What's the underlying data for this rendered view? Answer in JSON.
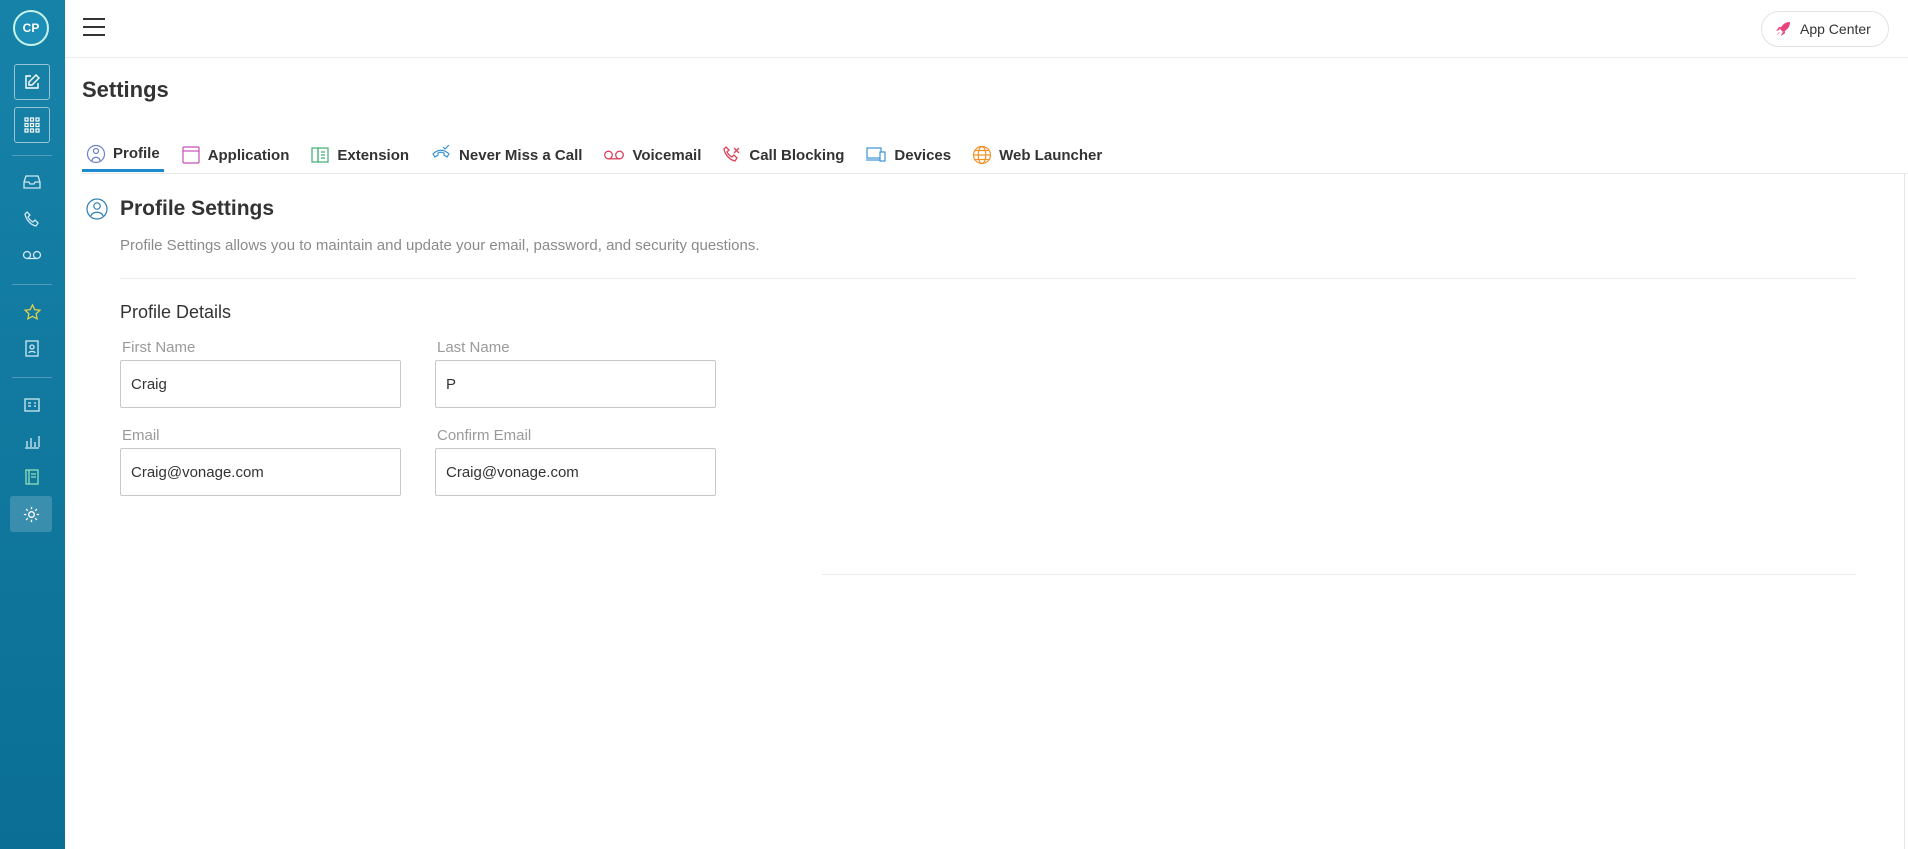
{
  "user": {
    "initials": "CP"
  },
  "header": {
    "app_center_label": "App Center"
  },
  "page": {
    "title": "Settings"
  },
  "tabs": [
    {
      "label": "Profile",
      "icon": "profile-icon",
      "active": true
    },
    {
      "label": "Application",
      "icon": "application-icon"
    },
    {
      "label": "Extension",
      "icon": "extension-icon"
    },
    {
      "label": "Never Miss a Call",
      "icon": "never-miss-call-icon"
    },
    {
      "label": "Voicemail",
      "icon": "voicemail-icon"
    },
    {
      "label": "Call Blocking",
      "icon": "call-blocking-icon"
    },
    {
      "label": "Devices",
      "icon": "devices-icon"
    },
    {
      "label": "Web Launcher",
      "icon": "web-launcher-icon"
    }
  ],
  "section": {
    "title": "Profile Settings",
    "description": "Profile Settings allows you to maintain and update your email, password, and security questions.",
    "details_title": "Profile Details"
  },
  "form": {
    "first_name": {
      "label": "First Name",
      "value": "Craig"
    },
    "last_name": {
      "label": "Last Name",
      "value": "P"
    },
    "email": {
      "label": "Email",
      "value": "Craig@vonage.com"
    },
    "confirm_email": {
      "label": "Confirm Email",
      "value": "Craig@vonage.com"
    }
  },
  "colors": {
    "sidebar": "#0b6f95",
    "accent": "#1a8bd0",
    "app_center_icon": "#e8447a"
  }
}
